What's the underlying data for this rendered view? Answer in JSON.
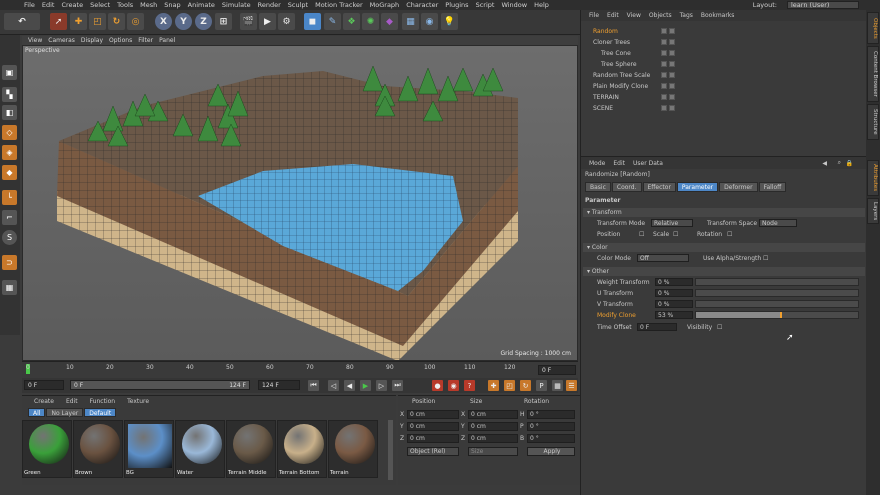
{
  "menu": [
    "File",
    "Edit",
    "Create",
    "Select",
    "Tools",
    "Mesh",
    "Snap",
    "Animate",
    "Simulate",
    "Render",
    "Sculpt",
    "Motion Tracker",
    "MoGraph",
    "Character",
    "Plugins",
    "Script",
    "Window",
    "Help"
  ],
  "layout": {
    "label": "Layout:",
    "value": "learn (User)"
  },
  "viewport": {
    "menu": [
      "View",
      "Cameras",
      "Display",
      "Options",
      "Filter",
      "Panel"
    ],
    "label": "Perspective",
    "grid_spacing": "Grid Spacing : 1000 cm"
  },
  "timeline": {
    "ticks": [
      "0",
      "10",
      "20",
      "30",
      "40",
      "50",
      "60",
      "70",
      "80",
      "90",
      "100",
      "110",
      "120"
    ],
    "current": "0 F"
  },
  "playback": {
    "start_field": "0 F",
    "slider_start": "0 F",
    "slider_end": "124 F",
    "end_field": "124 F"
  },
  "materials": {
    "menu": [
      "Create",
      "Edit",
      "Function",
      "Texture"
    ],
    "tabs": [
      "All",
      "No Layer",
      "Default"
    ],
    "items": [
      {
        "name": "Green",
        "color": "#3aa03a"
      },
      {
        "name": "Brown",
        "color": "#6a5240"
      },
      {
        "name": "BG",
        "color": "#5c8fc8"
      },
      {
        "name": "Water",
        "color": "#9ab8d8"
      },
      {
        "name": "Terrain Middle",
        "color": "#6a5a48"
      },
      {
        "name": "Terrain Bottom",
        "color": "#c8b08a"
      },
      {
        "name": "Terrain",
        "color": "#7a5a44"
      }
    ]
  },
  "coords": {
    "headers": [
      "Position",
      "Size",
      "Rotation"
    ],
    "rows": [
      {
        "axis": "X",
        "pos": "0 cm",
        "size_axis": "X",
        "size": "0 cm",
        "rot_axis": "H",
        "rot": "0 °"
      },
      {
        "axis": "Y",
        "pos": "0 cm",
        "size_axis": "Y",
        "size": "0 cm",
        "rot_axis": "P",
        "rot": "0 °"
      },
      {
        "axis": "Z",
        "pos": "0 cm",
        "size_axis": "Z",
        "size": "0 cm",
        "rot_axis": "B",
        "rot": "0 °"
      }
    ],
    "mode": "Object (Rel)",
    "size_mode": "Size",
    "apply": "Apply"
  },
  "objects": {
    "menu": [
      "File",
      "Edit",
      "View",
      "Objects",
      "Tags",
      "Bookmarks"
    ],
    "items": [
      {
        "name": "Random",
        "selected": true
      },
      {
        "name": "Cloner Trees",
        "selected": false
      },
      {
        "name": "Tree Cone",
        "selected": false
      },
      {
        "name": "Tree Sphere",
        "selected": false
      },
      {
        "name": "Random Tree Scale",
        "selected": false
      },
      {
        "name": "Plain Modify Clone",
        "selected": false
      },
      {
        "name": "TERRAIN",
        "selected": false
      },
      {
        "name": "SCENE",
        "selected": false
      }
    ]
  },
  "attributes": {
    "menu": [
      "Mode",
      "Edit",
      "User Data"
    ],
    "title": "Randomize [Random]",
    "tabs": [
      "Basic",
      "Coord.",
      "Effector",
      "Parameter",
      "Deformer",
      "Falloff"
    ],
    "section": "Parameter",
    "transform": {
      "header": "Transform",
      "mode_label": "Transform Mode",
      "mode_value": "Relative",
      "space_label": "Transform Space",
      "space_value": "Node",
      "position": "Position",
      "scale": "Scale",
      "rotation": "Rotation"
    },
    "color": {
      "header": "Color",
      "mode_label": "Color Mode",
      "mode_value": "Off",
      "alpha": "Use Alpha/Strength"
    },
    "other": {
      "header": "Other",
      "rows": [
        {
          "label": "Weight Transform",
          "value": "0 %",
          "fill": 0
        },
        {
          "label": "U Transform",
          "value": "0 %",
          "fill": 0
        },
        {
          "label": "V Transform",
          "value": "0 %",
          "fill": 0
        },
        {
          "label": "Modify Clone",
          "value": "53 %",
          "fill": 0.53
        }
      ],
      "time_offset_label": "Time Offset",
      "time_offset_value": "0 F",
      "visibility": "Visibility"
    }
  },
  "sidetabs": [
    "Objects",
    "Content Browser",
    "Structure",
    "Attributes",
    "Layers"
  ]
}
